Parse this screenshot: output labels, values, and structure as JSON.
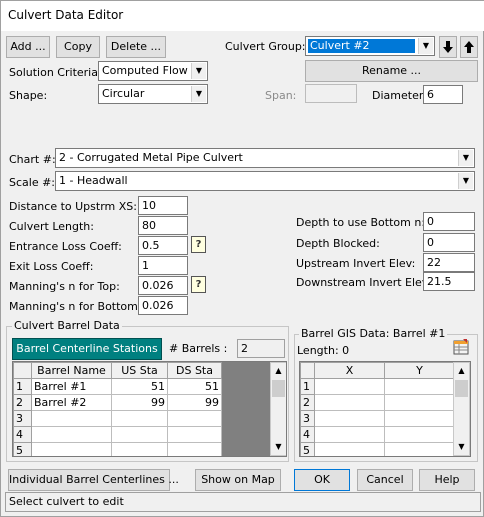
{
  "window": {
    "title": "Culvert Data Editor"
  },
  "toolbar": {
    "add_label": "Add ...",
    "copy_label": "Copy",
    "delete_label": "Delete ..."
  },
  "culvert_group": {
    "label": "Culvert Group:",
    "value": "Culvert #2",
    "rename_label": "Rename ..."
  },
  "solution": {
    "label": "Solution Criteria:",
    "value": "Computed Flow Co"
  },
  "shape": {
    "label": "Shape:",
    "value": "Circular"
  },
  "span": {
    "label": "Span:",
    "value": ""
  },
  "diameter": {
    "label": "Diameter:",
    "value": "6"
  },
  "chart": {
    "label": "Chart #:",
    "value": "2 - Corrugated Metal Pipe Culvert"
  },
  "scale": {
    "label": "Scale #:",
    "value": "1 - Headwall"
  },
  "params_left": [
    {
      "label": "Distance to Upstrm XS:",
      "value": "10"
    },
    {
      "label": "Culvert Length:",
      "value": "80"
    },
    {
      "label": "Entrance Loss Coeff:",
      "value": "0.5"
    },
    {
      "label": "Exit Loss Coeff:",
      "value": "1"
    },
    {
      "label": "Manning's n for Top:",
      "value": "0.026"
    },
    {
      "label": "Manning's n for Bottom:",
      "value": "0.026"
    }
  ],
  "params_right": [
    {
      "label": "Depth to use Bottom n:",
      "value": "0"
    },
    {
      "label": "Depth Blocked:",
      "value": "0"
    },
    {
      "label": "Upstream Invert Elev:",
      "value": "22"
    },
    {
      "label": "Downstream Invert Elev:",
      "value": "21.5"
    }
  ],
  "help_glyph": "?",
  "barrel_data": {
    "group_label": "Culvert Barrel Data",
    "centerline_button": "Barrel Centerline Stations",
    "num_barrels_label": "# Barrels :",
    "num_barrels": "2",
    "columns": [
      "Barrel Name",
      "US Sta",
      "DS Sta"
    ],
    "rows": [
      {
        "n": "1",
        "name": "Barrel #1",
        "us": "51",
        "ds": "51"
      },
      {
        "n": "2",
        "name": "Barrel #2",
        "us": "99",
        "ds": "99"
      },
      {
        "n": "3",
        "name": "",
        "us": "",
        "ds": ""
      },
      {
        "n": "4",
        "name": "",
        "us": "",
        "ds": ""
      },
      {
        "n": "5",
        "name": "",
        "us": "",
        "ds": ""
      }
    ]
  },
  "gis_data": {
    "group_label": "Barrel GIS Data: Barrel #1",
    "length_label": "Length: 0",
    "columns": [
      "X",
      "Y"
    ],
    "rows": [
      {
        "n": "1",
        "x": "",
        "y": ""
      },
      {
        "n": "2",
        "x": "",
        "y": ""
      },
      {
        "n": "3",
        "x": "",
        "y": ""
      },
      {
        "n": "4",
        "x": "",
        "y": ""
      },
      {
        "n": "5",
        "x": "",
        "y": ""
      }
    ]
  },
  "footer": {
    "individual_label": "Individual Barrel Centerlines ...",
    "show_map_label": "Show on Map",
    "ok_label": "OK",
    "cancel_label": "Cancel",
    "help_label": "Help"
  },
  "status": {
    "text": "Select culvert to edit"
  },
  "colors": {
    "accent": "#0078d7",
    "centerline_button": "#008080",
    "grid_fill": "#808080"
  }
}
